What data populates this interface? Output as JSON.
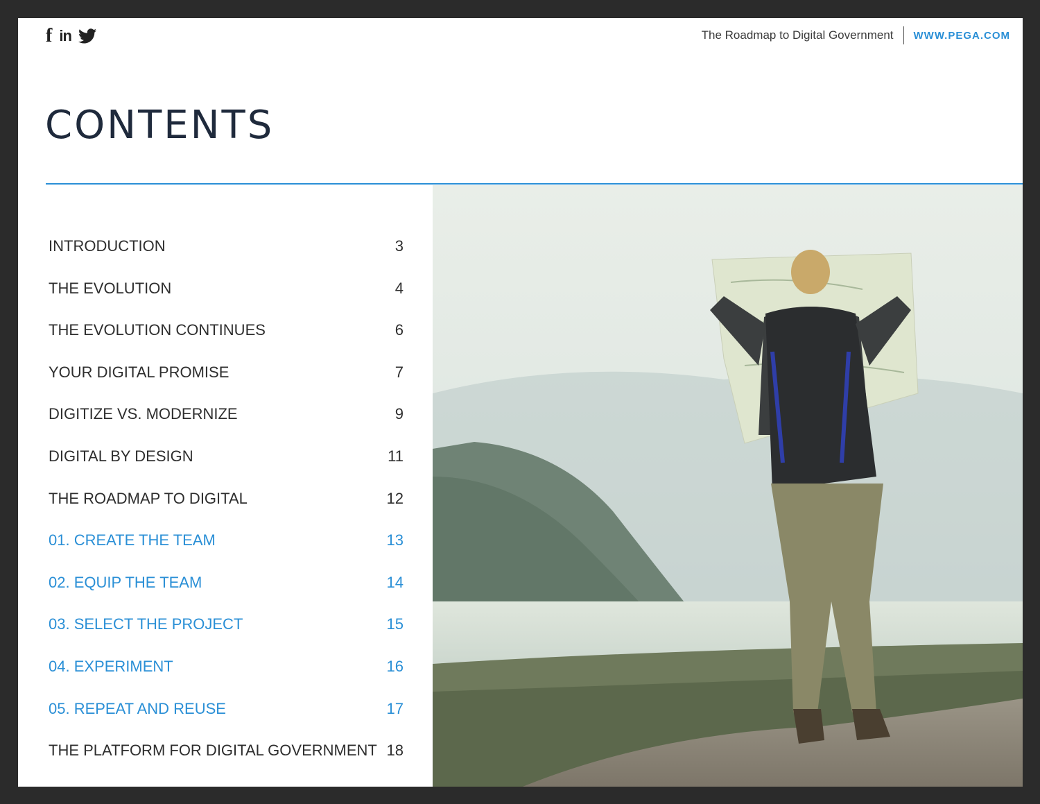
{
  "header": {
    "social": [
      "facebook-icon",
      "linkedin-icon",
      "twitter-icon"
    ],
    "social_labels": {
      "facebook": "f",
      "linkedin": "in"
    },
    "doc_title": "The Roadmap to Digital Government",
    "site_link": "WWW.PEGA.COM"
  },
  "title": "CONTENTS",
  "colors": {
    "accent": "#2a8fd6",
    "text": "#2e2e2e",
    "title": "#1f2a3c"
  },
  "toc": [
    {
      "label": "INTRODUCTION",
      "page": "3",
      "highlight": false
    },
    {
      "label": "THE EVOLUTION",
      "page": "4",
      "highlight": false
    },
    {
      "label": "THE EVOLUTION CONTINUES",
      "page": "6",
      "highlight": false
    },
    {
      "label": "YOUR DIGITAL PROMISE",
      "page": "7",
      "highlight": false
    },
    {
      "label": "DIGITIZE VS. MODERNIZE",
      "page": "9",
      "highlight": false
    },
    {
      "label": "DIGITAL BY DESIGN",
      "page": "11",
      "highlight": false
    },
    {
      "label": "THE ROADMAP TO DIGITAL",
      "page": "12",
      "highlight": false
    },
    {
      "label": "01. CREATE THE TEAM",
      "page": "13",
      "highlight": true
    },
    {
      "label": "02. EQUIP THE TEAM",
      "page": "14",
      "highlight": true
    },
    {
      "label": "03. SELECT THE PROJECT",
      "page": "15",
      "highlight": true
    },
    {
      "label": "04. EXPERIMENT",
      "page": "16",
      "highlight": true
    },
    {
      "label": "05. REPEAT AND REUSE",
      "page": "17",
      "highlight": true
    },
    {
      "label": "THE PLATFORM FOR DIGITAL GOVERNMENT",
      "page": "18",
      "highlight": false
    }
  ]
}
